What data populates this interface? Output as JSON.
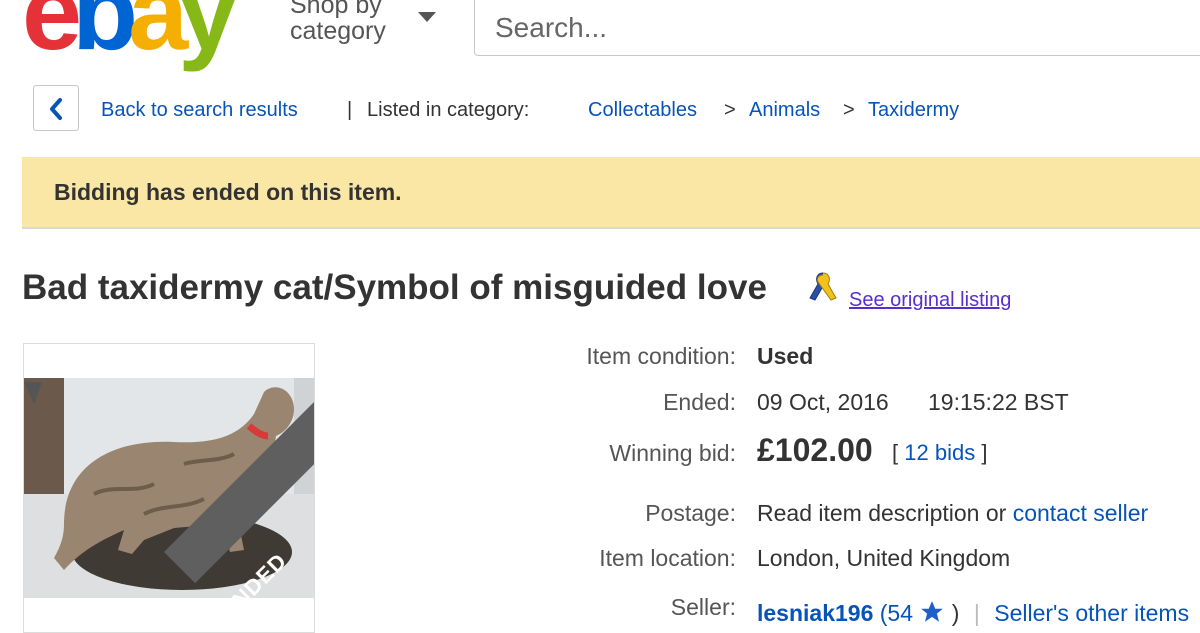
{
  "header": {
    "logo": {
      "e": "e",
      "b": "b",
      "a": "a",
      "y": "y"
    },
    "shop_by_line1": "Shop by",
    "shop_by_line2": "category",
    "search_placeholder": "Search..."
  },
  "breadcrumb": {
    "back_label": "Back to search results",
    "separator": "|",
    "listed_in_label": "Listed in category:",
    "categories": [
      "Collectables",
      "Animals",
      "Taxidermy"
    ],
    "chevron": ">"
  },
  "banner": {
    "text": "Bidding has ended on this item."
  },
  "item": {
    "title": "Bad taxidermy cat/Symbol of misguided love",
    "see_original_label": "See original listing",
    "ended_badge": "ENDED"
  },
  "details": {
    "condition_label": "Item condition:",
    "condition_value": "Used",
    "ended_label": "Ended:",
    "ended_date": "09 Oct, 2016",
    "ended_time": "19:15:22 BST",
    "winning_bid_label": "Winning bid:",
    "winning_bid_value": "£102.00",
    "bids_open": "[",
    "bids_count": "12 bids",
    "bids_close": "]",
    "postage_label": "Postage:",
    "postage_text": "Read item description or",
    "postage_link": "contact seller",
    "location_label": "Item location:",
    "location_value": "London, United Kingdom",
    "seller_label": "Seller:",
    "seller_name": "lesniak196",
    "seller_score": "(54",
    "seller_score_close": ")",
    "seller_sep": "|",
    "seller_other_link": "Seller's other items"
  },
  "colors": {
    "link": "#0654ba",
    "banner_bg": "#fae6a5",
    "visited_link": "#5a2ecc",
    "ended_ribbon": "#5f5f5f",
    "star": "#1e5fc8"
  }
}
